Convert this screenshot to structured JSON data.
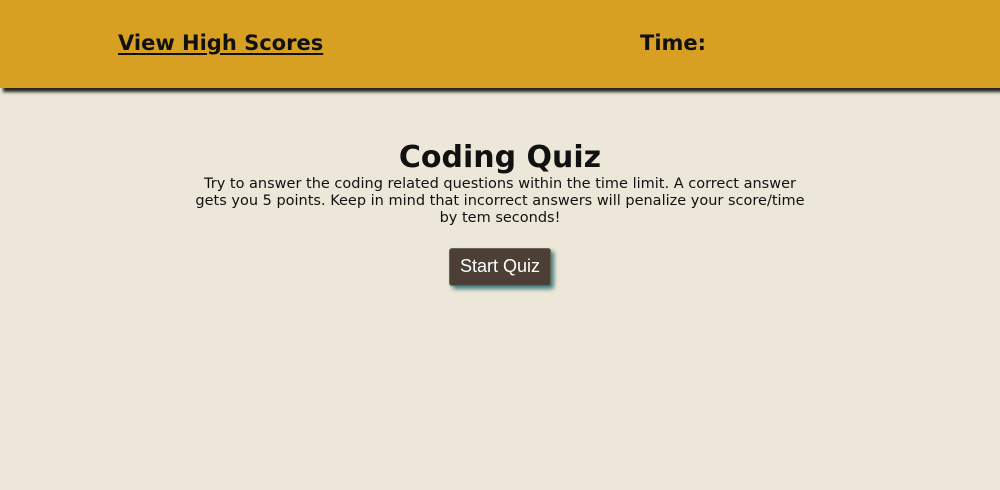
{
  "header": {
    "high_scores_link": "View High Scores",
    "timer_label": "Time:"
  },
  "main": {
    "title": "Coding Quiz",
    "description": "Try to answer the coding related questions within the time limit. A correct answer gets you 5 points. Keep in mind that incorrect answers will penalize your score/time by tem seconds!",
    "start_button": "Start Quiz"
  },
  "colors": {
    "header_background": "#d7a023",
    "page_background": "#ece7d8",
    "button_background": "#4b3f36"
  }
}
